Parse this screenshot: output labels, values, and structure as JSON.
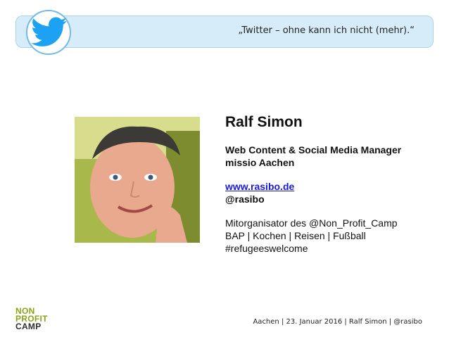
{
  "header": {
    "quote": "„Twitter – ohne kann ich nicht (mehr).“",
    "icon": "twitter-bird-icon",
    "accent": "#1da1f2"
  },
  "profile": {
    "name": "Ralf Simon",
    "role_line1": "Web Content & Social Media Manager",
    "role_line2": "missio Aachen",
    "website": "www.rasibo.de",
    "handle": "@rasibo",
    "bio_line1": "Mitorganisator des @Non_Profit_Camp",
    "bio_line2": "BAP | Kochen | Reisen | Fußball",
    "bio_line3": "#refugeeswelcome"
  },
  "footer": {
    "text": "Aachen | 23. Januar 2016 | Ralf Simon | @rasibo"
  },
  "logo": {
    "line1": "NON",
    "line2": "PROFIT",
    "line3": "CAMP"
  }
}
